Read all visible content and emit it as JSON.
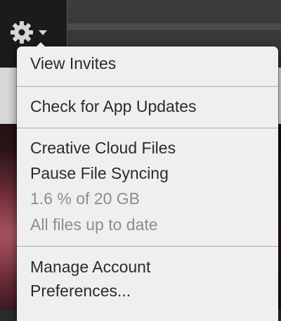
{
  "toolbar": {
    "gear_icon": "gear-icon",
    "dropdown_icon": "caret-down-icon"
  },
  "menu": {
    "view_invites": "View Invites",
    "check_updates": "Check for App Updates",
    "creative_cloud_files": "Creative Cloud Files",
    "pause_syncing": "Pause File Syncing",
    "storage_usage": "1.6 % of 20 GB",
    "sync_status": "All files up to date",
    "manage_account": "Manage Account",
    "preferences": "Preferences..."
  },
  "colors": {
    "menu_bg": "#efefef",
    "menu_text": "#2b2b2b",
    "muted_text": "#8d8d8d"
  }
}
